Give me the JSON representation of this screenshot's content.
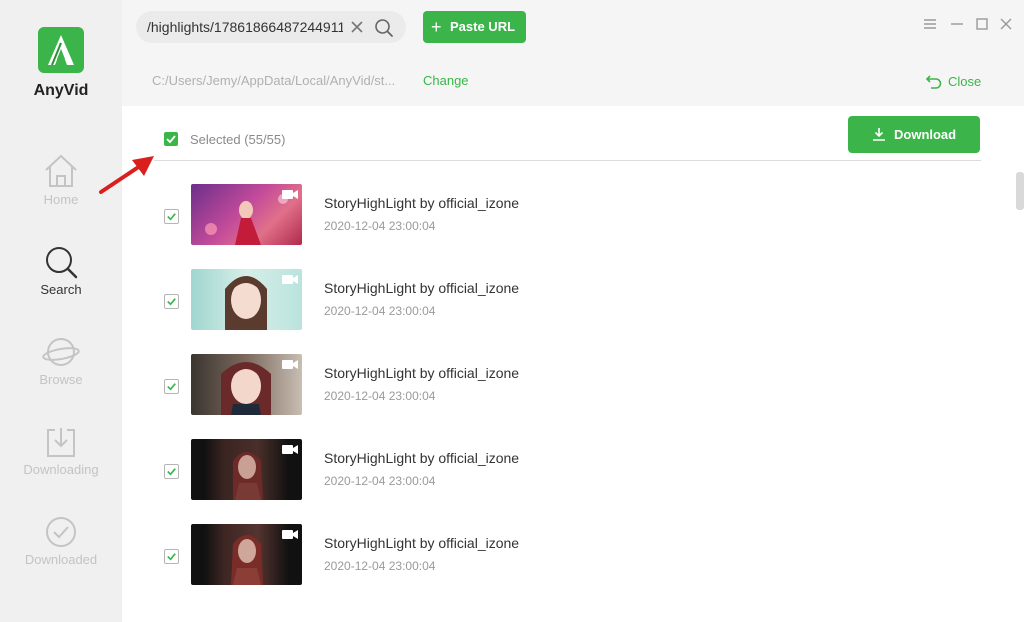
{
  "app": {
    "name": "AnyVid",
    "brand_color": "#3bb54a"
  },
  "sidebar": {
    "items": [
      {
        "label": "Home",
        "icon": "home-icon",
        "active": false
      },
      {
        "label": "Search",
        "icon": "search-icon",
        "active": true
      },
      {
        "label": "Browse",
        "icon": "planet-icon",
        "active": false
      },
      {
        "label": "Downloading",
        "icon": "download-tray-icon",
        "active": false
      },
      {
        "label": "Downloaded",
        "icon": "check-circle-icon",
        "active": false
      }
    ]
  },
  "search": {
    "value": "/highlights/17861866487244911/"
  },
  "toolbar": {
    "paste_label": "Paste URL"
  },
  "path": {
    "text": "C:/Users/Jemy/AppData/Local/AnyVid/st...",
    "change_label": "Change",
    "close_label": "Close"
  },
  "selection": {
    "label": "Selected (55/55)",
    "checked": true
  },
  "download": {
    "label": "Download"
  },
  "items": [
    {
      "title": "StoryHighLight by official_izone",
      "date": "2020-12-04 23:00:04",
      "checked": true
    },
    {
      "title": "StoryHighLight by official_izone",
      "date": "2020-12-04 23:00:04",
      "checked": true
    },
    {
      "title": "StoryHighLight by official_izone",
      "date": "2020-12-04 23:00:04",
      "checked": true
    },
    {
      "title": "StoryHighLight by official_izone",
      "date": "2020-12-04 23:00:04",
      "checked": true
    },
    {
      "title": "StoryHighLight by official_izone",
      "date": "2020-12-04 23:00:04",
      "checked": true
    }
  ]
}
